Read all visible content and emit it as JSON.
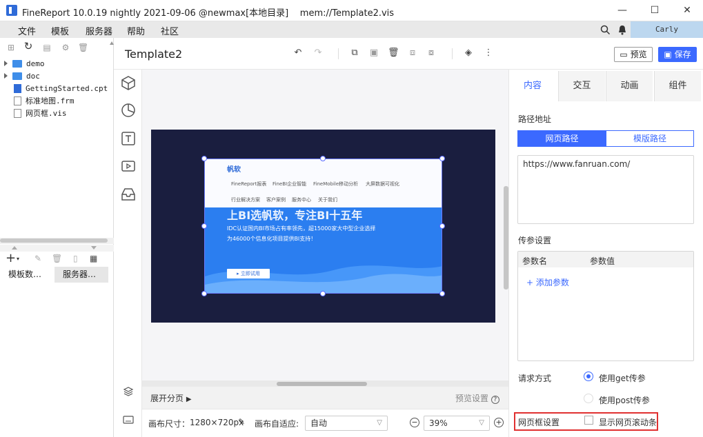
{
  "window": {
    "title": "FineReport 10.0.19 nightly 2021-09-06 @newmax[本地目录]    mem://Template2.vis",
    "minimize": "—",
    "maximize": "☐",
    "close": "✕"
  },
  "menu": {
    "items": [
      "文件",
      "模板",
      "服务器",
      "帮助",
      "社区"
    ],
    "user": "Carly"
  },
  "file_tree": {
    "items": [
      {
        "name": "demo",
        "type": "folder"
      },
      {
        "name": "doc",
        "type": "folder"
      },
      {
        "name": "GettingStarted.cpt",
        "type": "file"
      },
      {
        "name": "标准地图.frm",
        "type": "file"
      },
      {
        "name": "网页框.vis",
        "type": "file"
      }
    ]
  },
  "left_tabs": [
    "模板数…",
    "服务器…"
  ],
  "document": {
    "title": "Template2",
    "preview_label": "预览",
    "save_label": "保存"
  },
  "webframe_content": {
    "brand": "帆软",
    "nav1": [
      "FineReport报表",
      "FineBI企业智能",
      "FineMobile移动分析",
      "大屏数据可视化"
    ],
    "nav2": [
      "行业解决方案",
      "客户案例",
      "服务中心",
      "关于我们"
    ],
    "headline": "上BI选帆软，专注BI十五年",
    "line1": "IDC认证国内BI市场占有率领先，超15000家大中型企业选择",
    "line2": "为46000个信息化项目提供BI支持！",
    "cta": "▸ 立即试用"
  },
  "canvas_footer": {
    "pages_toggle": "展开分页",
    "preview_settings": "预览设置",
    "size_label": "画布尺寸：",
    "size_value": "1280×720px",
    "fit_label": "画布自适应:",
    "fit_value": "自动",
    "zoom_value": "39%"
  },
  "right_panel": {
    "tabs": [
      "内容",
      "交互",
      "动画",
      "组件"
    ],
    "path_label": "路径地址",
    "seg_web": "网页路径",
    "seg_template": "模版路径",
    "url": "https://www.fanruan.com/",
    "params_label": "传参设置",
    "col_name": "参数名",
    "col_value": "参数值",
    "add_param": "+ 添加参数",
    "request_label": "请求方式",
    "get_option": "使用get传参",
    "post_option": "使用post传参",
    "frame_settings": "网页框设置",
    "scroll_option": "显示网页滚动条",
    "highlight_color": "#e03030",
    "accent": "#3b69ff"
  }
}
